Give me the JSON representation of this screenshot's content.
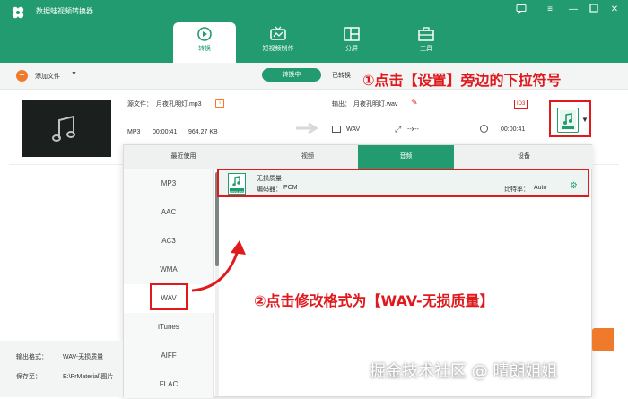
{
  "app": {
    "title": "数据蛙视频转换器",
    "window_controls": [
      "chat-icon",
      "menu-icon",
      "minimize-icon",
      "maximize-icon",
      "close-icon"
    ]
  },
  "tabs": [
    {
      "label": "转换",
      "icon": "convert-icon",
      "active": true
    },
    {
      "label": "短视频制作",
      "icon": "tv-icon",
      "active": false
    },
    {
      "label": "分屏",
      "icon": "split-icon",
      "active": false
    },
    {
      "label": "工具",
      "icon": "toolbox-icon",
      "active": false
    }
  ],
  "toolbar": {
    "add_file_label": "添加文件",
    "converting_label": "转换中",
    "converted_label": "已转换"
  },
  "file": {
    "source_label": "源文件：",
    "source_name": "月夜孔明灯.mp3",
    "format": "MP3",
    "duration": "00:00:41",
    "size": "964.27 KB",
    "output_label": "输出：",
    "output_name": "月夜孔明灯.wav",
    "out_format": "WAV",
    "out_resolution": "--x--",
    "out_duration": "00:00:41",
    "badge": "ID3"
  },
  "format_panel": {
    "tabs": [
      {
        "label": "最近使用",
        "active": false
      },
      {
        "label": "视频",
        "active": false
      },
      {
        "label": "音频",
        "active": true
      },
      {
        "label": "设备",
        "active": false
      }
    ],
    "formats": [
      "MP3",
      "AAC",
      "AC3",
      "WMA",
      "WAV",
      "iTunes",
      "AIFF",
      "FLAC"
    ],
    "selected_format": "WAV",
    "preset": {
      "name": "无损质量",
      "encoder_label": "编码器：",
      "encoder": "PCM",
      "bitrate_label": "比特率：",
      "bitrate": "Auto",
      "icon_text": "LOSSLESS"
    }
  },
  "bottom": {
    "output_format_label": "输出格式：",
    "output_format_value": "WAV-无损质量",
    "save_to_label": "保存至：",
    "save_to_value": "E:\\PrMaterial\\图片"
  },
  "annotations": {
    "step1": "①点击【设置】旁边的下拉符号",
    "step2": "②点击修改格式为【WAV-无损质量】"
  },
  "watermark": "掘金技术社区 @ 晴朗姐姐",
  "colors": {
    "brand": "#219b6f",
    "accent_orange": "#f07a2b",
    "annotation_red": "#e0191d"
  }
}
